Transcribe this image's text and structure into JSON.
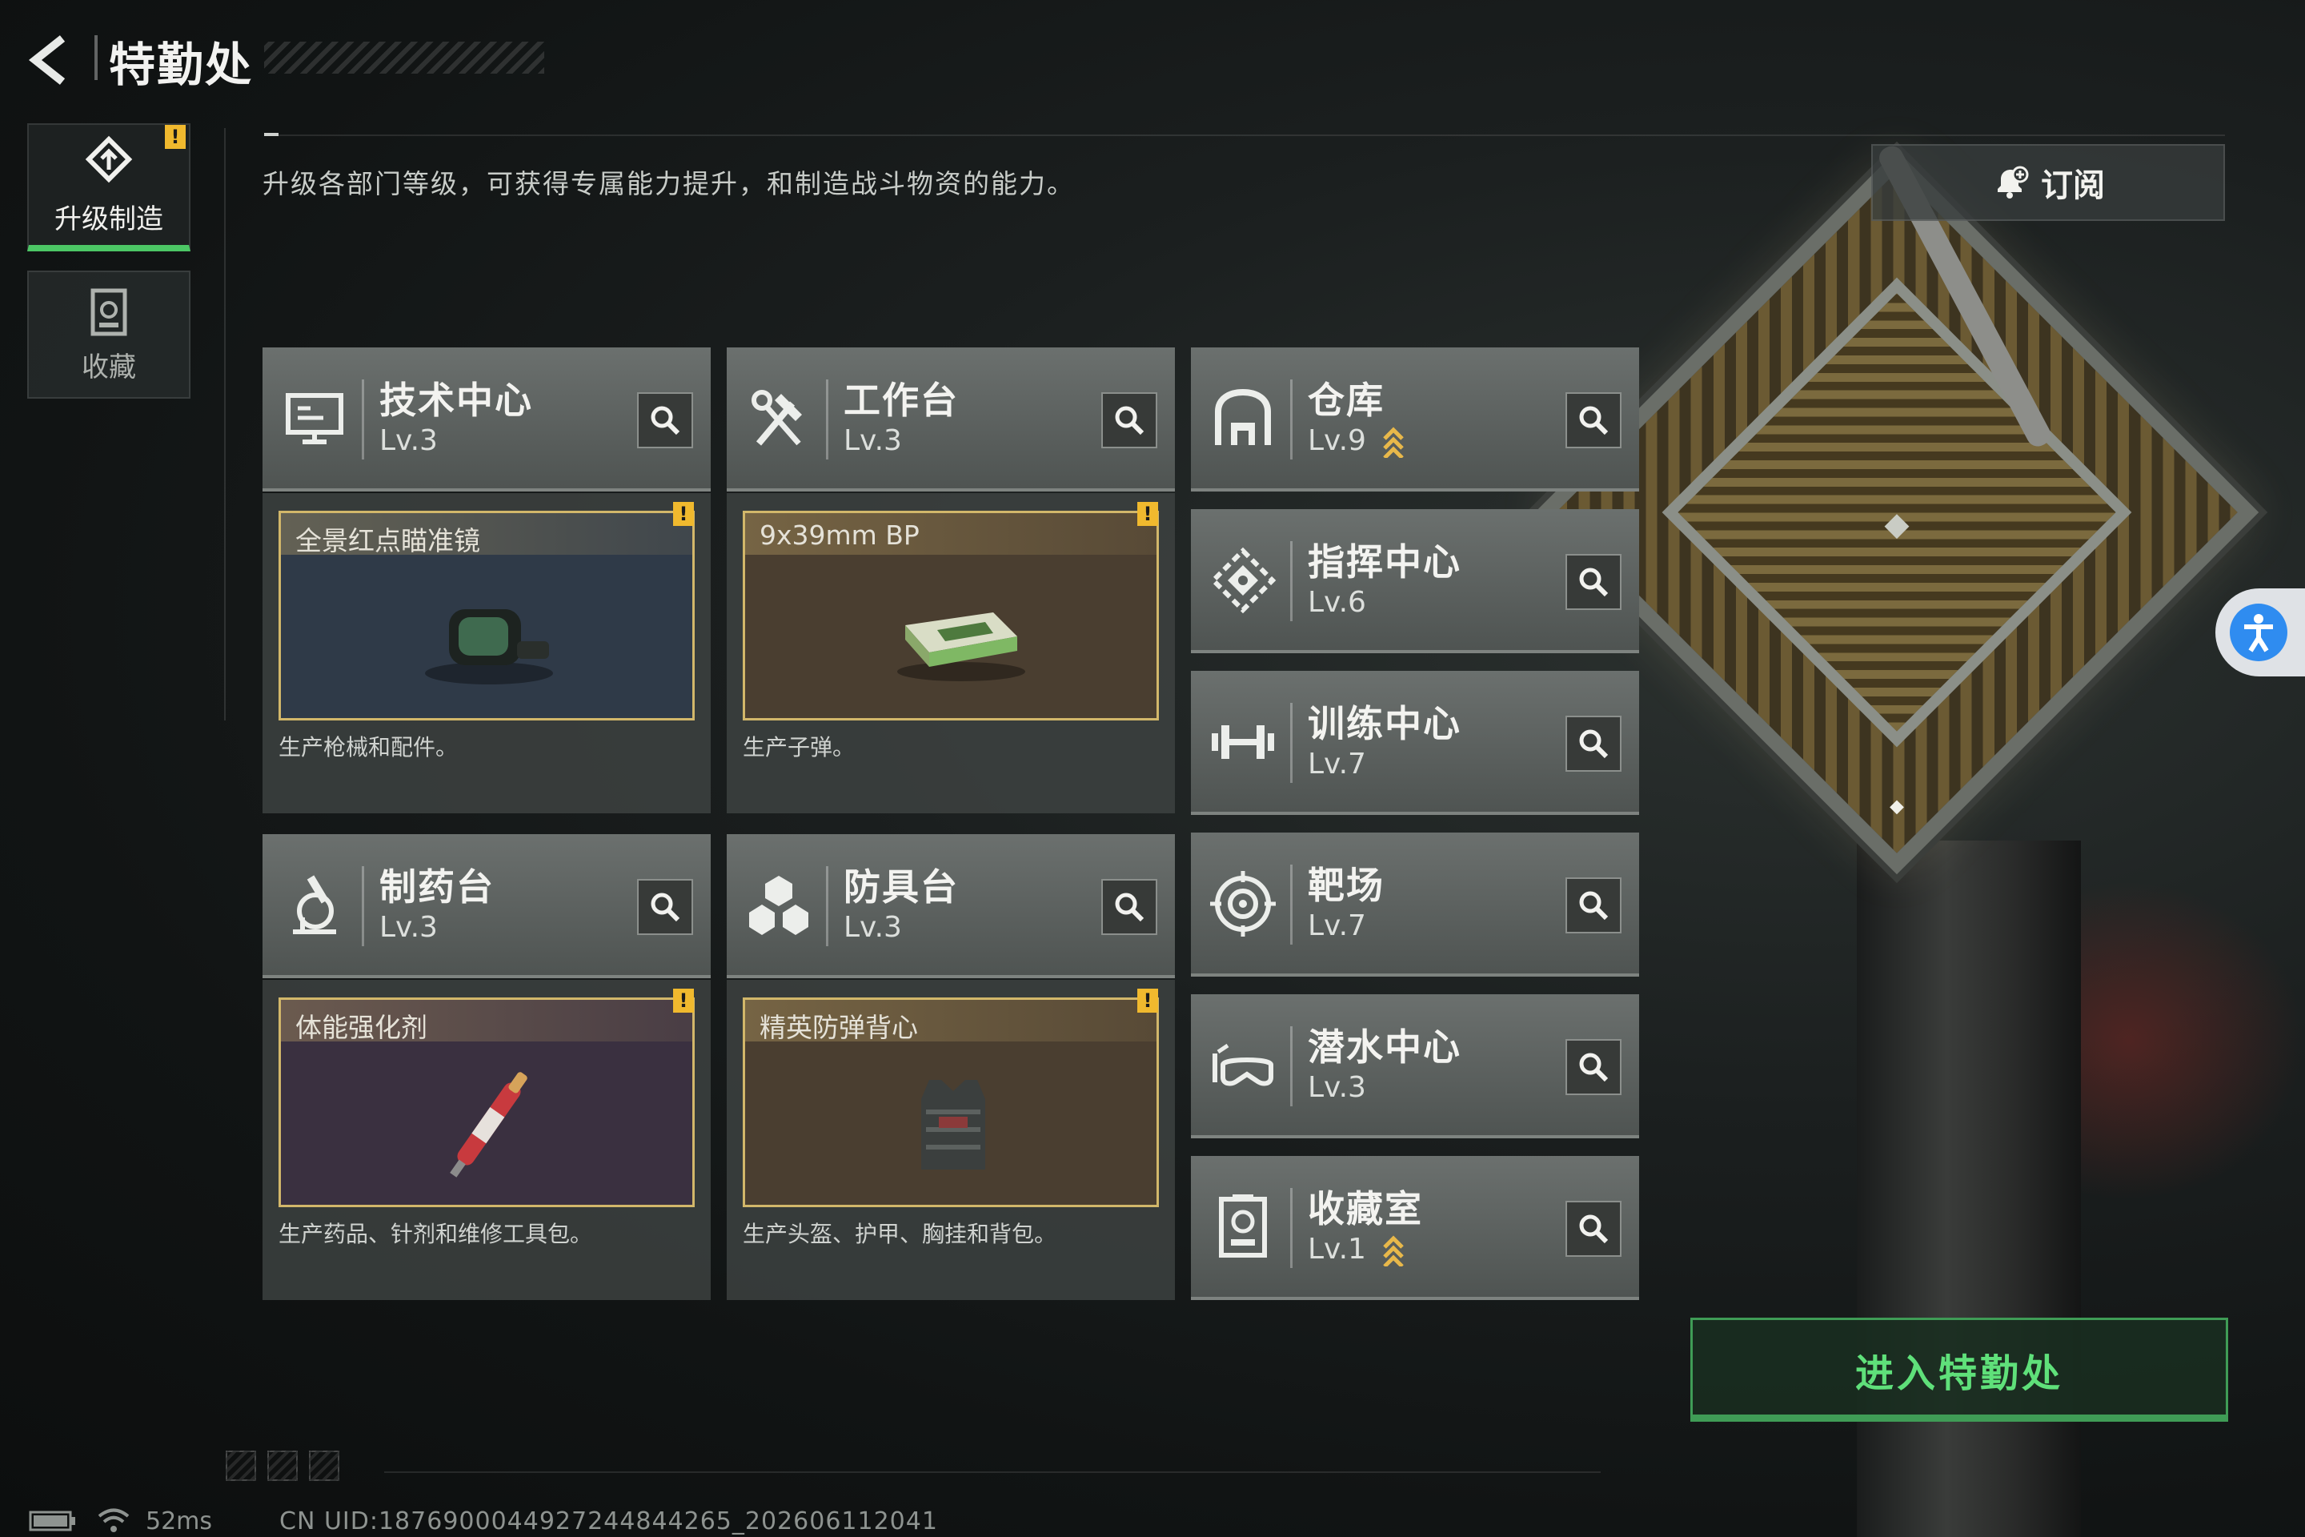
{
  "header": {
    "title": "特勤处"
  },
  "nav": [
    {
      "label": "升级制造",
      "active": true,
      "alert": "!"
    },
    {
      "label": "收藏",
      "active": false
    }
  ],
  "description": "升级各部门等级，可获得专属能力提升，和制造战斗物资的能力。",
  "subscribe_label": "订阅",
  "departments": [
    {
      "name": "技术中心",
      "level": "Lv.3",
      "icon": "monitor-icon",
      "upgradable": false
    },
    {
      "name": "工作台",
      "level": "Lv.3",
      "icon": "hammer-wrench-icon",
      "upgradable": false
    },
    {
      "name": "仓库",
      "level": "Lv.9",
      "icon": "warehouse-icon",
      "upgradable": true
    },
    {
      "name": "指挥中心",
      "level": "Lv.6",
      "icon": "command-compass-icon",
      "upgradable": false
    },
    {
      "name": "训练中心",
      "level": "Lv.7",
      "icon": "dumbbell-icon",
      "upgradable": false
    },
    {
      "name": "制药台",
      "level": "Lv.3",
      "icon": "microscope-icon",
      "upgradable": false
    },
    {
      "name": "防具台",
      "level": "Lv.3",
      "icon": "cubes-icon",
      "upgradable": false
    },
    {
      "name": "靶场",
      "level": "Lv.7",
      "icon": "target-icon",
      "upgradable": false
    },
    {
      "name": "潜水中心",
      "level": "Lv.3",
      "icon": "diving-mask-icon",
      "upgradable": false
    },
    {
      "name": "收藏室",
      "level": "Lv.1",
      "icon": "trophy-case-icon",
      "upgradable": true
    }
  ],
  "products": [
    {
      "name": "全景红点瞄准镜",
      "desc": "生产枪械和配件。",
      "alert": "!",
      "theme_color": "#2f3a48"
    },
    {
      "name": "9x39mm BP",
      "desc": "生产子弹。",
      "alert": "!",
      "theme_color": "#4a3e30"
    },
    {
      "name": "体能强化剂",
      "desc": "生产药品、针剂和维修工具包。",
      "alert": "!",
      "theme_color": "#3a3040"
    },
    {
      "name": "精英防弹背心",
      "desc": "生产头盔、护甲、胸挂和背包。",
      "alert": "!",
      "theme_color": "#4a3e30"
    }
  ],
  "enter_label": "进入特勤处",
  "status": {
    "ping": "52ms",
    "uid": "CN UID:18769000449272448442​65_202606112041"
  },
  "colors": {
    "accent_green": "#4cc765",
    "alert_yellow": "#f0b92e",
    "upgrade_gold": "#e8b84a"
  }
}
